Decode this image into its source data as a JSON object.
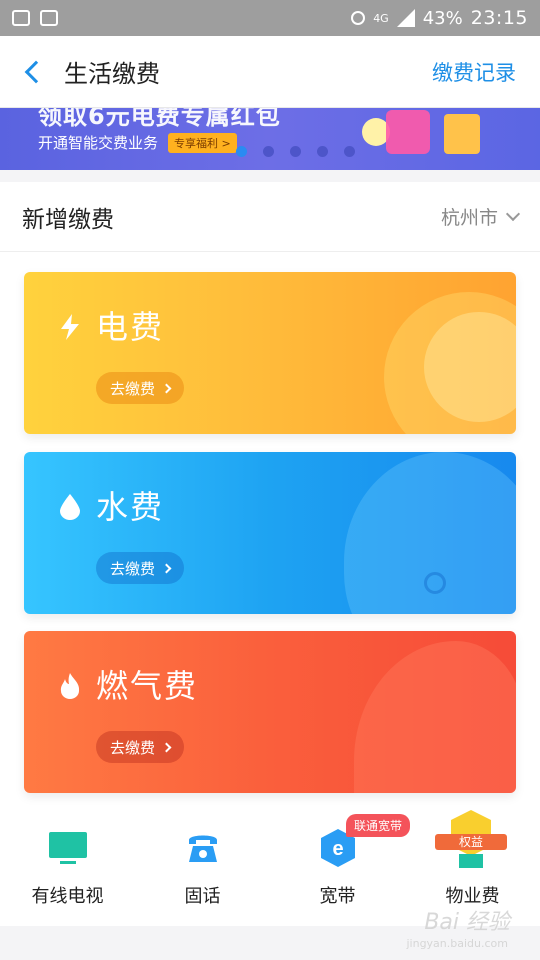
{
  "status_bar": {
    "battery": "43%",
    "time": "23:15",
    "network": "4G"
  },
  "nav": {
    "title": "生活缴费",
    "right_action": "缴费记录"
  },
  "banner": {
    "title": "领取6元电费专属红包",
    "subtitle": "开通智能交费业务",
    "tag": "专享福利 >",
    "dot_count": 5,
    "active_dot": 0
  },
  "section": {
    "title": "新增缴费",
    "city": "杭州市"
  },
  "cards": [
    {
      "title": "电费",
      "button": "去缴费",
      "icon": "lightning-icon"
    },
    {
      "title": "水费",
      "button": "去缴费",
      "icon": "water-drop-icon"
    },
    {
      "title": "燃气费",
      "button": "去缴费",
      "icon": "flame-icon"
    }
  ],
  "grid": [
    {
      "label": "有线电视",
      "icon": "tv-icon"
    },
    {
      "label": "固话",
      "icon": "telephone-icon"
    },
    {
      "label": "宽带",
      "icon": "broadband-icon",
      "badge": "联通宽带"
    },
    {
      "label": "物业费",
      "icon": "property-icon",
      "badge": "权益"
    }
  ],
  "watermark": {
    "text": "Bai 经验",
    "sub": "jingyan.baidu.com"
  },
  "colors": {
    "accent": "#1e8fe6",
    "electric": "#ffbd3b",
    "water": "#1ea3f2",
    "gas": "#fa5f3c"
  }
}
